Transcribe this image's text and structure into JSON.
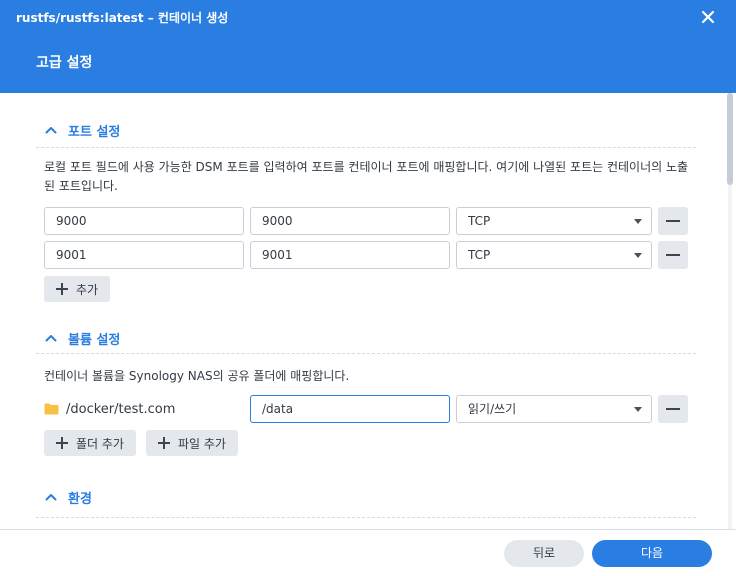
{
  "window": {
    "title": "rustfs/rustfs:latest – 컨테이너 생성",
    "heading": "고급 설정",
    "accent_color": "#2a7de1"
  },
  "ports": {
    "section_label": "포트 설정",
    "description": "로컬 포트 필드에 사용 가능한 DSM 포트를 입력하여 포트를 컨테이너 포트에 매핑합니다. 여기에 나열된 포트는 컨테이너의 노출된 포트입니다.",
    "rows": [
      {
        "local_port": "9000",
        "container_port": "9000",
        "protocol": "TCP"
      },
      {
        "local_port": "9001",
        "container_port": "9001",
        "protocol": "TCP"
      }
    ],
    "add_label": "추가"
  },
  "volumes": {
    "section_label": "볼륨 설정",
    "description": "컨테이너 볼륨을 Synology NAS의 공유 폴더에 매핑합니다.",
    "rows": [
      {
        "host_path": "/docker/test.com",
        "mount_path": "/data",
        "permission": "읽기/쓰기"
      }
    ],
    "add_folder_label": "폴더 추가",
    "add_file_label": "파일 추가"
  },
  "environment": {
    "section_label": "환경"
  },
  "footer": {
    "back_label": "뒤로",
    "next_label": "다음"
  }
}
